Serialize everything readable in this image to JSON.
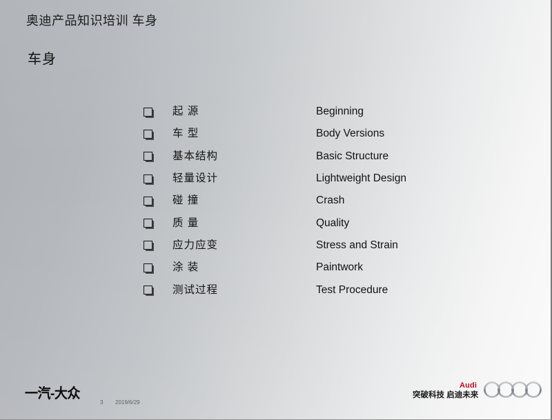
{
  "slide": {
    "title": "奥迪产品知识培训  车身",
    "subtitle": "车身",
    "background_gradient_from": "#adb1b6",
    "background_gradient_to": "#fbfbfb"
  },
  "agenda": {
    "bullet_icon": "hollow-square-bullet",
    "items": [
      {
        "cn": "起 源",
        "en": "Beginning"
      },
      {
        "cn": "车 型",
        "en": "Body Versions"
      },
      {
        "cn": "基本结构",
        "en": "Basic Structure"
      },
      {
        "cn": "轻量设计",
        "en": "Lightweight Design"
      },
      {
        "cn": "碰 撞",
        "en": "Crash"
      },
      {
        "cn": "质 量",
        "en": "Quality"
      },
      {
        "cn": "应力应变",
        "en": "Stress and Strain"
      },
      {
        "cn": "涂 装",
        "en": "Paintwork"
      },
      {
        "cn": "测试过程",
        "en": "Test Procedure"
      }
    ]
  },
  "footer": {
    "faw_vw_logo": "一汽-大众",
    "slide_number": "3",
    "date": "2019/6/29",
    "audi_wordmark": "Audi",
    "audi_slogan": "突破科技 启迪未来",
    "audi_rings_icon": "audi-four-rings-icon",
    "audi_red": "#bb0a1e",
    "rings_gray": "#8c9094"
  }
}
